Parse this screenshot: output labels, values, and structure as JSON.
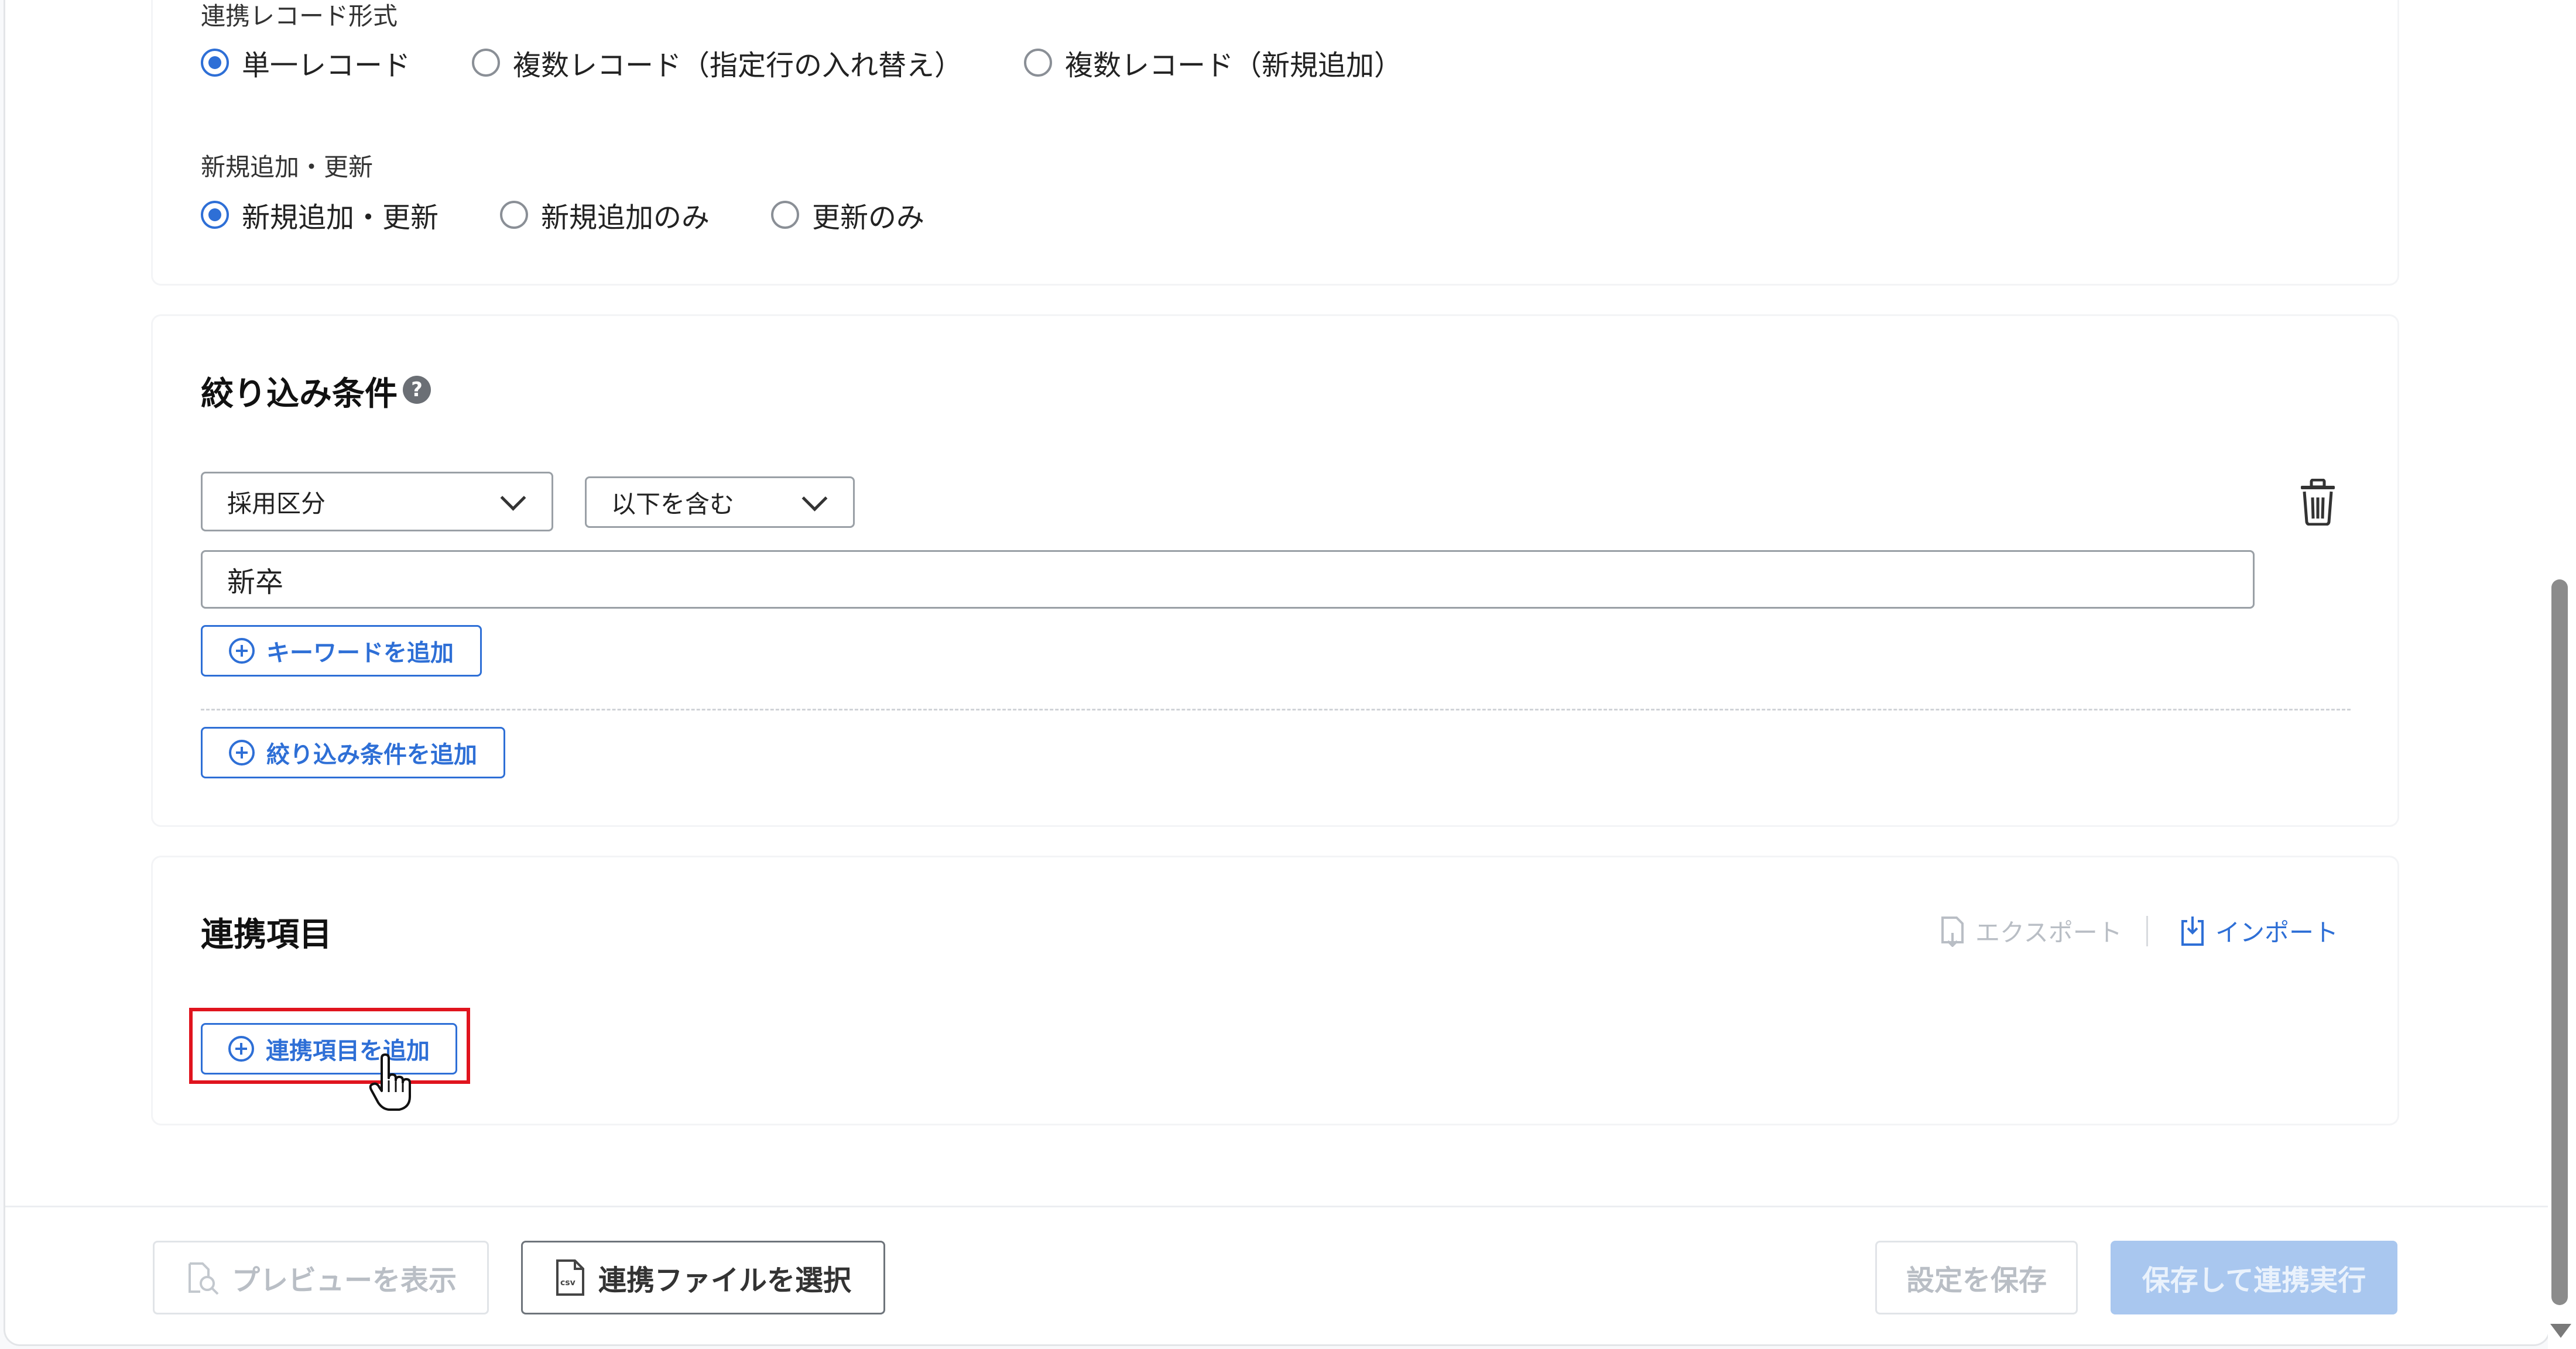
{
  "record_format": {
    "label": "連携レコード形式",
    "options": [
      {
        "label": "単一レコード",
        "checked": true
      },
      {
        "label": "複数レコード（指定行の入れ替え）",
        "checked": false
      },
      {
        "label": "複数レコード（新規追加）",
        "checked": false
      }
    ]
  },
  "upsert_mode": {
    "label": "新規追加・更新",
    "options": [
      {
        "label": "新規追加・更新",
        "checked": true
      },
      {
        "label": "新規追加のみ",
        "checked": false
      },
      {
        "label": "更新のみ",
        "checked": false
      }
    ]
  },
  "filter_section": {
    "title": "絞り込み条件",
    "help_icon": "?",
    "field_select_value": "採用区分",
    "operator_select_value": "以下を含む",
    "keyword_value": "新卒",
    "add_keyword_label": "キーワードを追加",
    "add_filter_label": "絞り込み条件を追加"
  },
  "linked_items_section": {
    "title": "連携項目",
    "export_label": "エクスポート",
    "import_label": "インポート",
    "add_item_label": "連携項目を追加"
  },
  "footer": {
    "preview_label": "プレビューを表示",
    "select_file_label": "連携ファイルを選択",
    "save_settings_label": "設定を保存",
    "save_and_run_label": "保存して連携実行"
  },
  "colors": {
    "accent": "#2e6fd6",
    "highlight": "#e0141e",
    "disabled_text": "#b9bec5",
    "disabled_primary_bg": "#a9c7ef"
  }
}
